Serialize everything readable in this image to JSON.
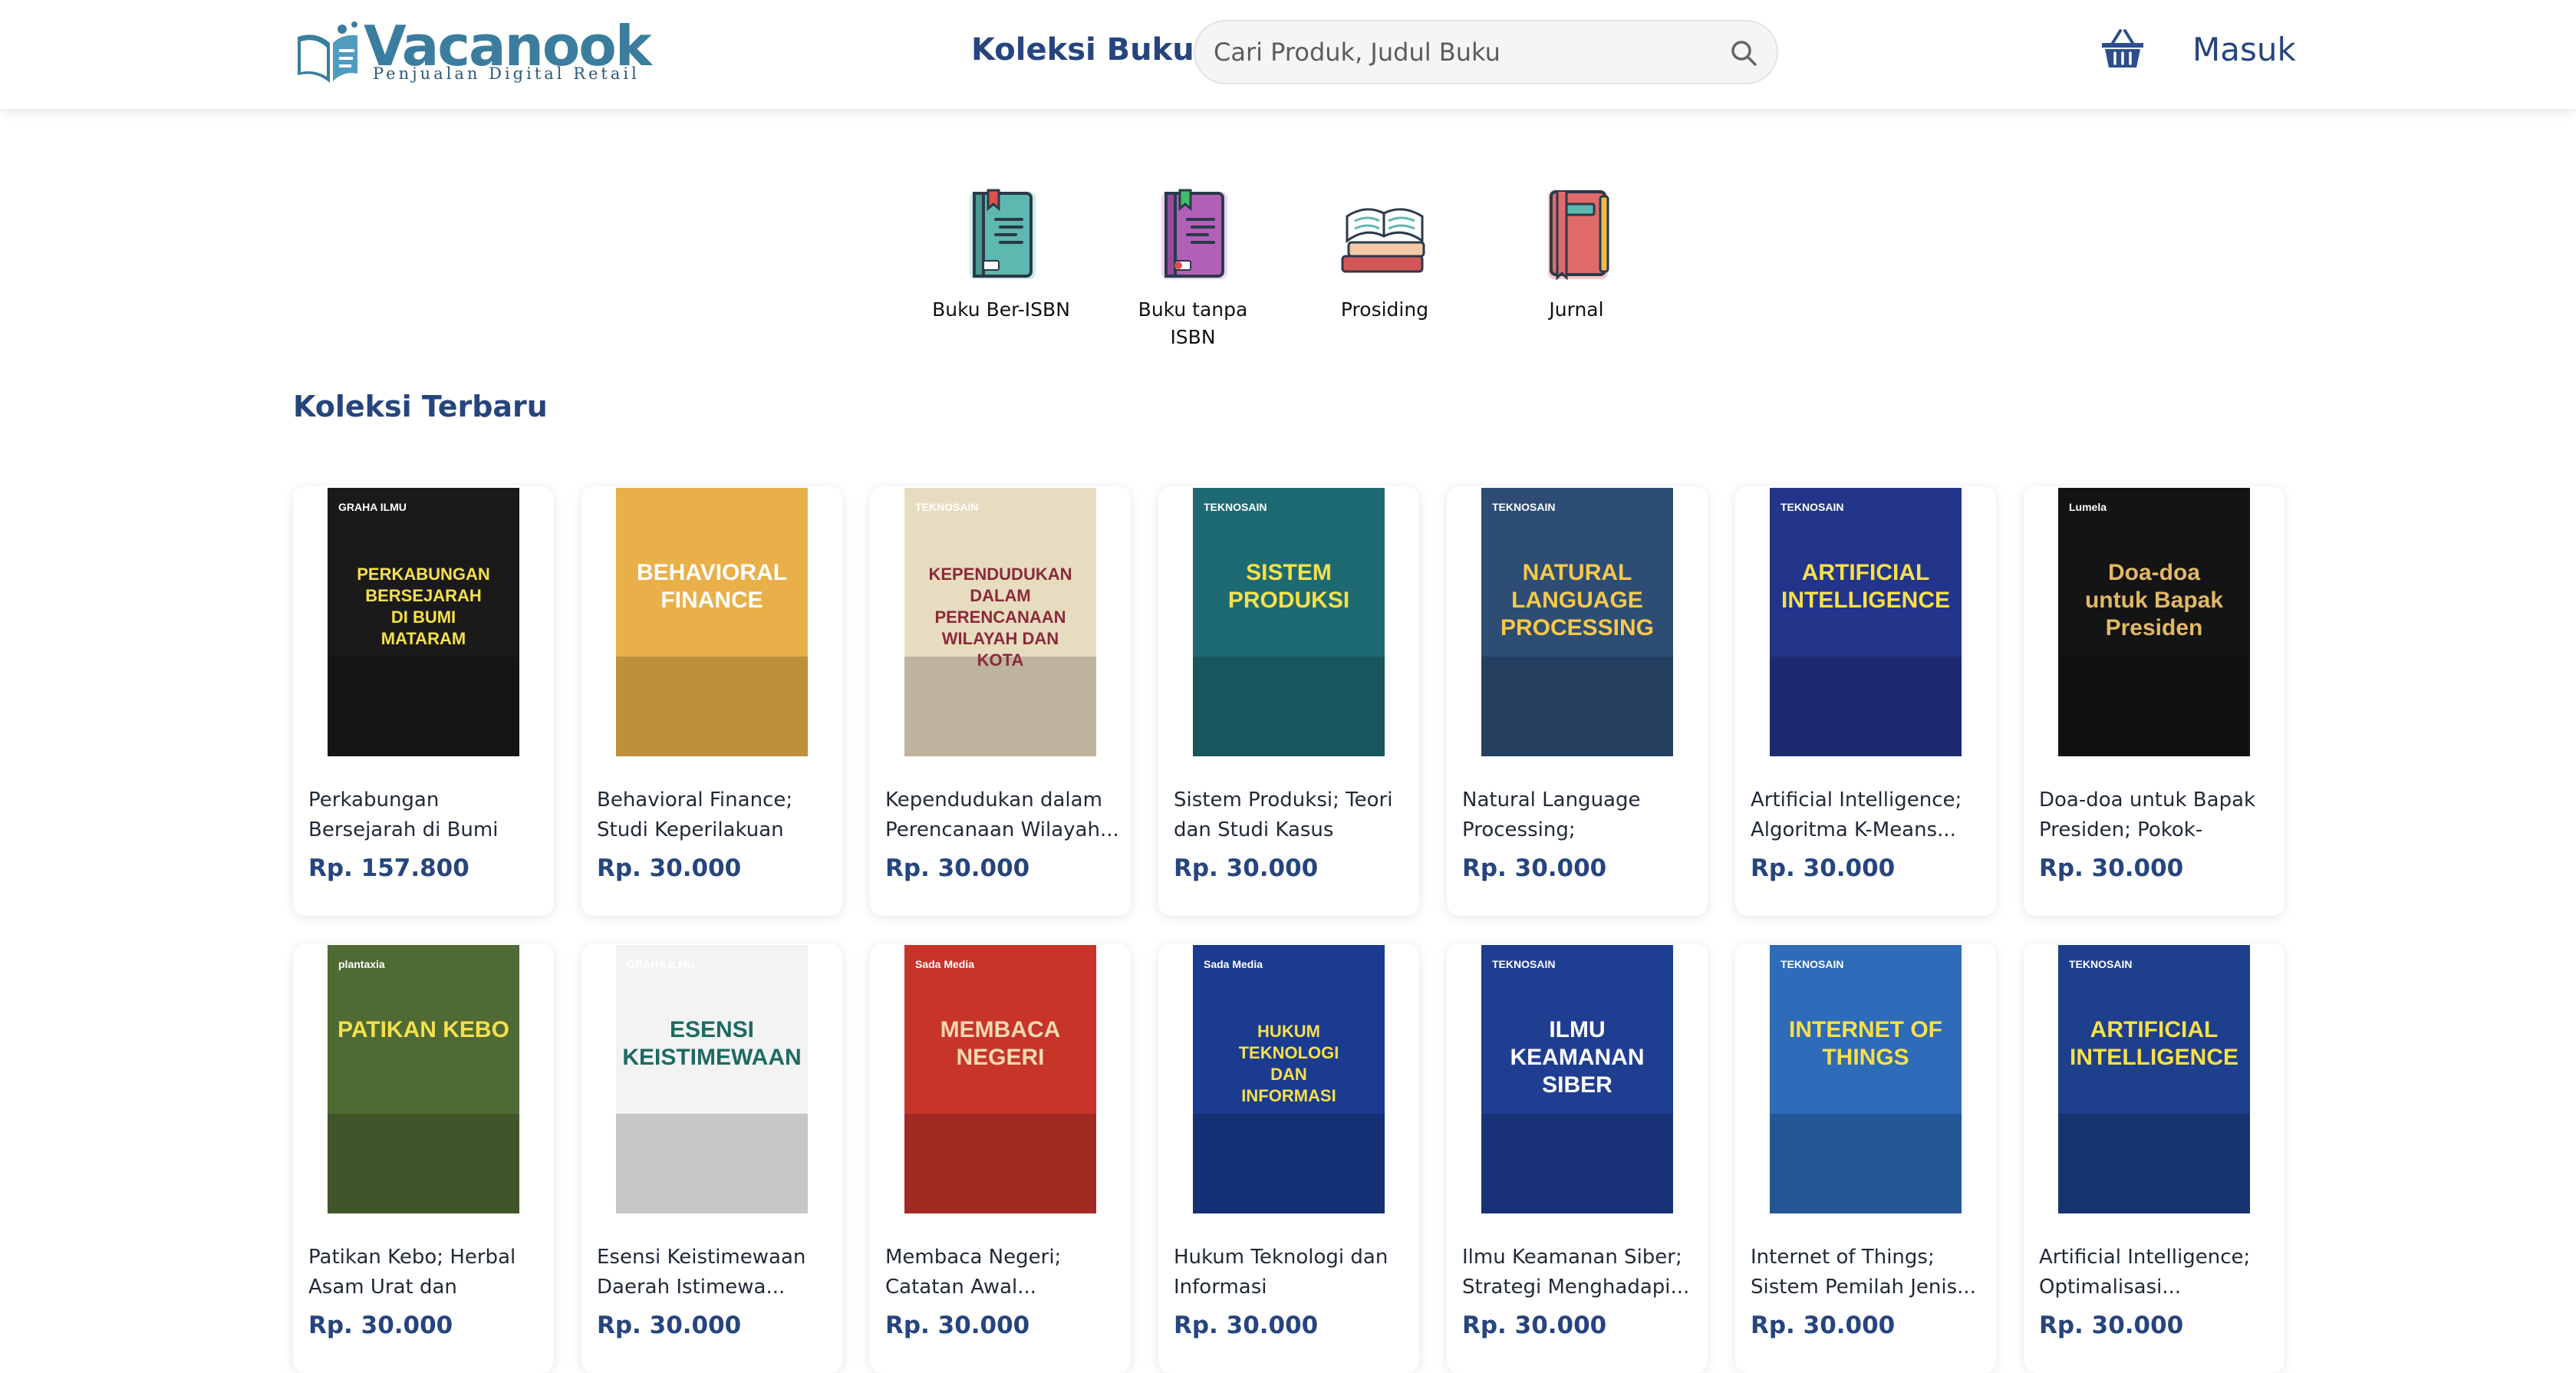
{
  "header": {
    "logo_name": "Vacanook",
    "logo_tagline": "Penjualan Digital Retail",
    "nav_collection": "Koleksi Buku",
    "search_placeholder": "Cari Produk, Judul Buku",
    "login": "Masuk"
  },
  "categories": [
    {
      "label": "Buku Ber-ISBN",
      "icon": "isbn-book-icon",
      "color": "#5fb8b0"
    },
    {
      "label": "Buku tanpa ISBN",
      "icon": "book-without-isbn-icon",
      "color": "#b160b8"
    },
    {
      "label": "Prosiding",
      "icon": "proceedings-icon",
      "color": "#d45757"
    },
    {
      "label": "Jurnal",
      "icon": "journal-icon",
      "color": "#e06b6b"
    }
  ],
  "section_title": "Koleksi Terbaru",
  "books": [
    {
      "title": "Perkabungan Bersejarah di Bumi Mataram Edisi ...",
      "price": "Rp. 157.800",
      "cover_title": "PERKABUNGAN BERSEJARAH DI BUMI MATARAM",
      "publisher": "GRAHA ILMU",
      "bg": "#1a1a1a",
      "accent": "#f6e04a"
    },
    {
      "title": "Behavioral Finance; Studi Keperilakuan dalam...",
      "price": "Rp. 30.000",
      "cover_title": "BEHAVIORAL FINANCE",
      "publisher": "",
      "bg": "#e9b04a",
      "accent": "#ffffff"
    },
    {
      "title": "Kependudukan dalam Perencanaan Wilayah...",
      "price": "Rp. 30.000",
      "cover_title": "KEPENDUDUKAN DALAM PERENCANAAN WILAYAH DAN KOTA",
      "publisher": "TEKNOSAIN",
      "bg": "#e8dcc0",
      "accent": "#8a2a3a"
    },
    {
      "title": "Sistem Produksi; Teori dan Studi Kasus",
      "price": "Rp. 30.000",
      "cover_title": "SISTEM PRODUKSI",
      "publisher": "TEKNOSAIN",
      "bg": "#1e6a73",
      "accent": "#f6e04a"
    },
    {
      "title": "Natural Language Processing; Pemrosesa...",
      "price": "Rp. 30.000",
      "cover_title": "NATURAL LANGUAGE PROCESSING",
      "publisher": "TEKNOSAIN",
      "bg": "#2d4d75",
      "accent": "#f6c84a"
    },
    {
      "title": "Artificial Intelligence; Algoritma K-Means...",
      "price": "Rp. 30.000",
      "cover_title": "ARTIFICIAL INTELLIGENCE",
      "publisher": "TEKNOSAIN",
      "bg": "#23358a",
      "accent": "#f6e04a"
    },
    {
      "title": "Doa-doa untuk Bapak Presiden; Pokok-pokok...",
      "price": "Rp. 30.000",
      "cover_title": "Doa-doa untuk Bapak Presiden",
      "publisher": "Lumela",
      "bg": "#141414",
      "accent": "#e2b866"
    },
    {
      "title": "Patikan Kebo; Herbal Asam Urat dan Manfaat...",
      "price": "Rp. 30.000",
      "cover_title": "PATIKAN KEBO",
      "publisher": "plantaxia",
      "bg": "#4f6a34",
      "accent": "#f6e04a"
    },
    {
      "title": "Esensi Keistimewaan Daerah Istimewa...",
      "price": "Rp. 30.000",
      "cover_title": "ESENSI KEISTIMEWAAN",
      "publisher": "GRAHA ILMU",
      "bg": "#f3f3f3",
      "accent": "#1e6a63"
    },
    {
      "title": "Membaca Negeri; Catatan Awal...",
      "price": "Rp. 30.000",
      "cover_title": "MEMBACA NEGERI",
      "publisher": "Sada Media",
      "bg": "#c6342a",
      "accent": "#f4d9b0"
    },
    {
      "title": "Hukum Teknologi dan Informasi",
      "price": "Rp. 30.000",
      "cover_title": "HUKUM TEKNOLOGI DAN INFORMASI",
      "publisher": "Sada Media",
      "bg": "#1a3b8f",
      "accent": "#f6e04a"
    },
    {
      "title": "Ilmu Keamanan Siber; Strategi Menghadapi...",
      "price": "Rp. 30.000",
      "cover_title": "ILMU KEAMANAN SIBER",
      "publisher": "TEKNOSAIN",
      "bg": "#1f3e92",
      "accent": "#ffffff"
    },
    {
      "title": "Internet of Things; Sistem Pemilah Jenis...",
      "price": "Rp. 30.000",
      "cover_title": "INTERNET OF THINGS",
      "publisher": "TEKNOSAIN",
      "bg": "#2e6bb8",
      "accent": "#f6e04a"
    },
    {
      "title": "Artificial Intelligence; Optimalisasi...",
      "price": "Rp. 30.000",
      "cover_title": "ARTIFICIAL INTELLIGENCE",
      "publisher": "TEKNOSAIN",
      "bg": "#1d3f8c",
      "accent": "#f6e04a"
    }
  ]
}
